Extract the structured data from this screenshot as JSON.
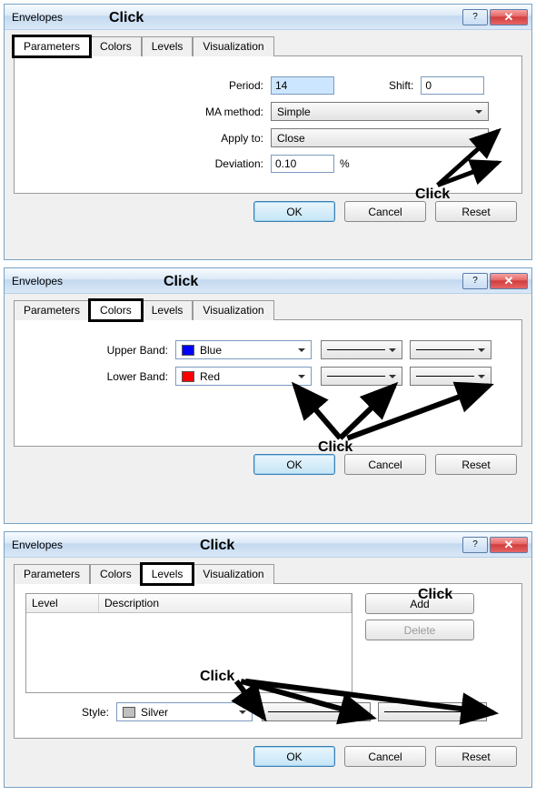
{
  "common": {
    "title": "Envelopes",
    "tabs": {
      "parameters": "Parameters",
      "colors": "Colors",
      "levels": "Levels",
      "visualization": "Visualization"
    },
    "buttons": {
      "ok": "OK",
      "cancel": "Cancel",
      "reset": "Reset",
      "add": "Add",
      "delete": "Delete"
    },
    "click": "Click"
  },
  "parameters": {
    "period_label": "Period:",
    "period_value": "14",
    "shift_label": "Shift:",
    "shift_value": "0",
    "ma_label": "MA method:",
    "ma_value": "Simple",
    "apply_label": "Apply to:",
    "apply_value": "Close",
    "dev_label": "Deviation:",
    "dev_value": "0.10",
    "pct": "%"
  },
  "colors": {
    "upper_label": "Upper Band:",
    "upper_value": "Blue",
    "upper_hex": "#0000ff",
    "lower_label": "Lower Band:",
    "lower_value": "Red",
    "lower_hex": "#ff0000"
  },
  "levels": {
    "col_level": "Level",
    "col_desc": "Description",
    "style_label": "Style:",
    "style_value": "Silver",
    "style_hex": "#c0c0c0"
  }
}
